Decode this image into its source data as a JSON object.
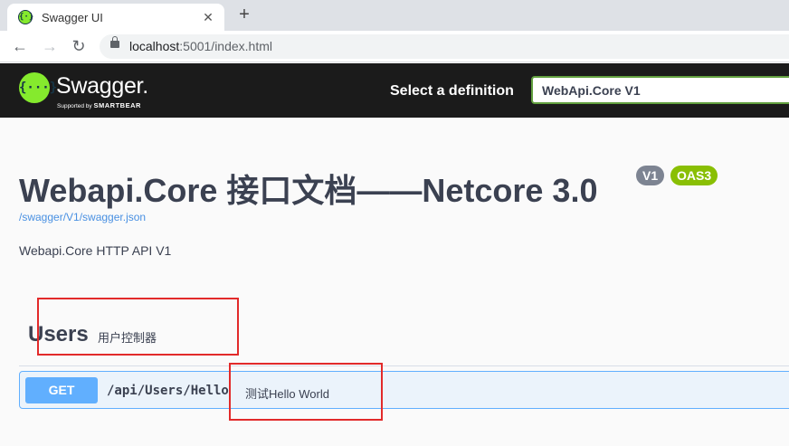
{
  "browser": {
    "tab_title": "Swagger UI",
    "favicon_glyph": "{·}",
    "close_glyph": "✕",
    "new_tab_glyph": "+",
    "back_glyph": "←",
    "forward_glyph": "→",
    "reload_glyph": "↻",
    "url_host": "localhost",
    "url_path": ":5001/index.html"
  },
  "topbar": {
    "logo_glyph": "{···}",
    "logo_text": "Swagger.",
    "logo_sub": "Supported by",
    "logo_sub_brand": "SMARTBEAR",
    "definition_label": "Select a definition",
    "definition_value": "WebApi.Core V1",
    "brand_color": "#85ea2d"
  },
  "info": {
    "title": "Webapi.Core 接口文档——Netcore 3.0",
    "version_badge": "V1",
    "oas_badge": "OAS3",
    "json_link": "/swagger/V1/swagger.json",
    "description": "Webapi.Core HTTP API V1"
  },
  "tags": [
    {
      "name": "Users",
      "description": "用户控制器",
      "operations": [
        {
          "method": "GET",
          "path": "/api/Users/Hello",
          "summary": "测试Hello World",
          "color": "#61affe"
        }
      ]
    }
  ]
}
